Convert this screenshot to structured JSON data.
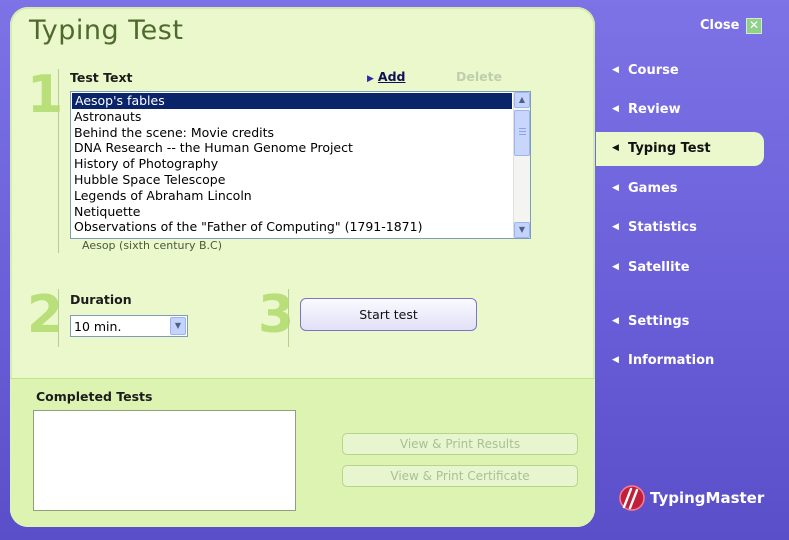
{
  "title": "Typing Test",
  "step1": {
    "number": "1",
    "label": "Test Text",
    "add_label": "Add",
    "delete_label": "Delete",
    "items": [
      "Aesop's fables",
      "Astronauts",
      "Behind the scene: Movie credits",
      "DNA Research -- the Human Genome Project",
      "History of Photography",
      "Hubble Space Telescope",
      "Legends of Abraham Lincoln",
      "Netiquette",
      "Observations of the \"Father of Computing\" (1791-1871)"
    ],
    "selected_index": 0,
    "author": "Aesop (sixth century B.C)"
  },
  "step2": {
    "number": "2",
    "label": "Duration",
    "value": "10 min."
  },
  "step3": {
    "number": "3",
    "start_label": "Start test"
  },
  "completed": {
    "label": "Completed Tests",
    "view_results_label": "View & Print Results",
    "view_certificate_label": "View & Print Certificate"
  },
  "close_label": "Close",
  "nav": [
    {
      "label": "Course",
      "active": false
    },
    {
      "label": "Review",
      "active": false
    },
    {
      "label": "Typing Test",
      "active": true
    },
    {
      "label": "Games",
      "active": false
    },
    {
      "label": "Statistics",
      "active": false
    },
    {
      "label": "Satellite",
      "active": false
    },
    {
      "label": "Settings",
      "active": false
    },
    {
      "label": "Information",
      "active": false
    }
  ],
  "brand": "TypingMaster",
  "colors": {
    "panel": "#eaf8cc",
    "sidebar": "#7a6fe0",
    "selection": "#0a246a",
    "step_number": "#b9df7a"
  }
}
